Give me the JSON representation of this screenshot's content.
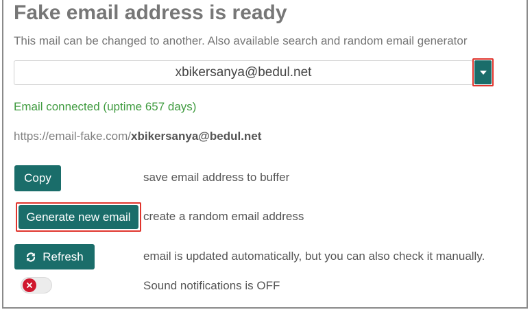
{
  "header": {
    "title": "Fake email address is ready",
    "subtitle": "This mail can be changed to another. Also available search and random email generator"
  },
  "email": {
    "address": "xbikersanya@bedul.net",
    "dropdown_icon": "caret-down-icon"
  },
  "status": {
    "text": "Email connected (uptime 657 days)",
    "color": "#3f9b3f"
  },
  "link": {
    "prefix": "https://email-fake.com/",
    "address": "xbikersanya@bedul.net"
  },
  "actions": {
    "copy_label": "Copy",
    "copy_desc": "save email address to buffer",
    "generate_label": "Generate new email",
    "generate_desc": "create a random email address",
    "refresh_label": "Refresh",
    "refresh_icon": "refresh-icon",
    "refresh_desc": "email is updated automatically, but you can also check it manually.",
    "sound_desc": "Sound notifications is OFF",
    "sound_state": "off"
  },
  "colors": {
    "accent": "#1a6d6a",
    "highlight": "#e0342c",
    "toggle_off": "#d0182e"
  }
}
